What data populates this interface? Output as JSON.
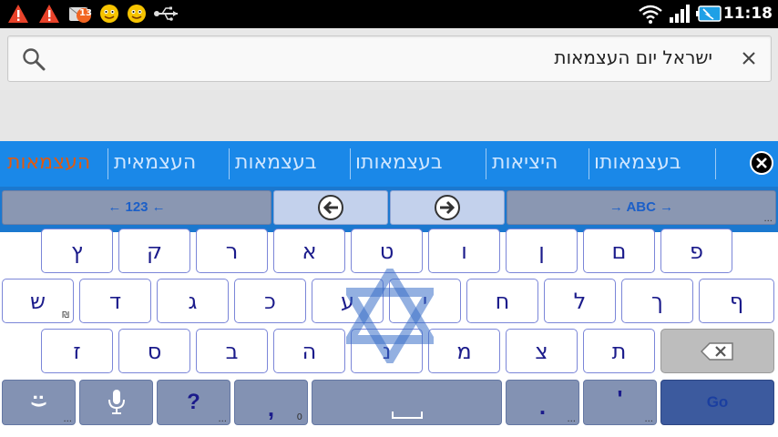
{
  "status_bar": {
    "clock": "11:18",
    "notification_icons": [
      "warning-icon",
      "warning-icon",
      "missed-call-icon",
      "emoticon-icon",
      "emoticon-icon",
      "usb-icon"
    ],
    "missed_count": "13",
    "right_icons": [
      "wifi-icon",
      "signal-icon",
      "battery-icon"
    ]
  },
  "search": {
    "query": "ישראל יום העצמאות",
    "icon": "search-icon",
    "clear_icon": "close-icon"
  },
  "suggestions": {
    "items": [
      "העצמאות",
      "העצמאית",
      "בעצמאות",
      "בעצמאותו",
      "היציאות",
      "בעצמאותו"
    ],
    "highlight_color": "#e05a10",
    "bar_color": "#1a88e8"
  },
  "keyboard": {
    "numbers_key": "← 123 ←",
    "abc_key": "→ ABC →",
    "left_arrow_icon": "arrow-left-icon",
    "right_arrow_icon": "arrow-right-icon",
    "rows": [
      [
        "ץ",
        "ק",
        "ר",
        "א",
        "ט",
        "ו",
        "ן",
        "ם",
        "פ"
      ],
      [
        "ש",
        "ד",
        "ג",
        "כ",
        "ע",
        "י",
        "ח",
        "ל",
        "ך",
        "ף"
      ],
      [
        "ז",
        "ס",
        "ב",
        "ה",
        "נ",
        "מ",
        "צ",
        "ת"
      ]
    ],
    "shekel_hint": "₪",
    "bottom": {
      "emoji_key": ":)",
      "mic_key": "mic-icon",
      "question_key": "?",
      "comma_key": ",",
      "comma_hint": "0",
      "period_key": ".",
      "apostrophe_key": "'",
      "go_key": "Go",
      "backspace_icon": "backspace-icon"
    },
    "key_text_color": "#1b1b8b",
    "accent_color": "#1b78cf"
  }
}
